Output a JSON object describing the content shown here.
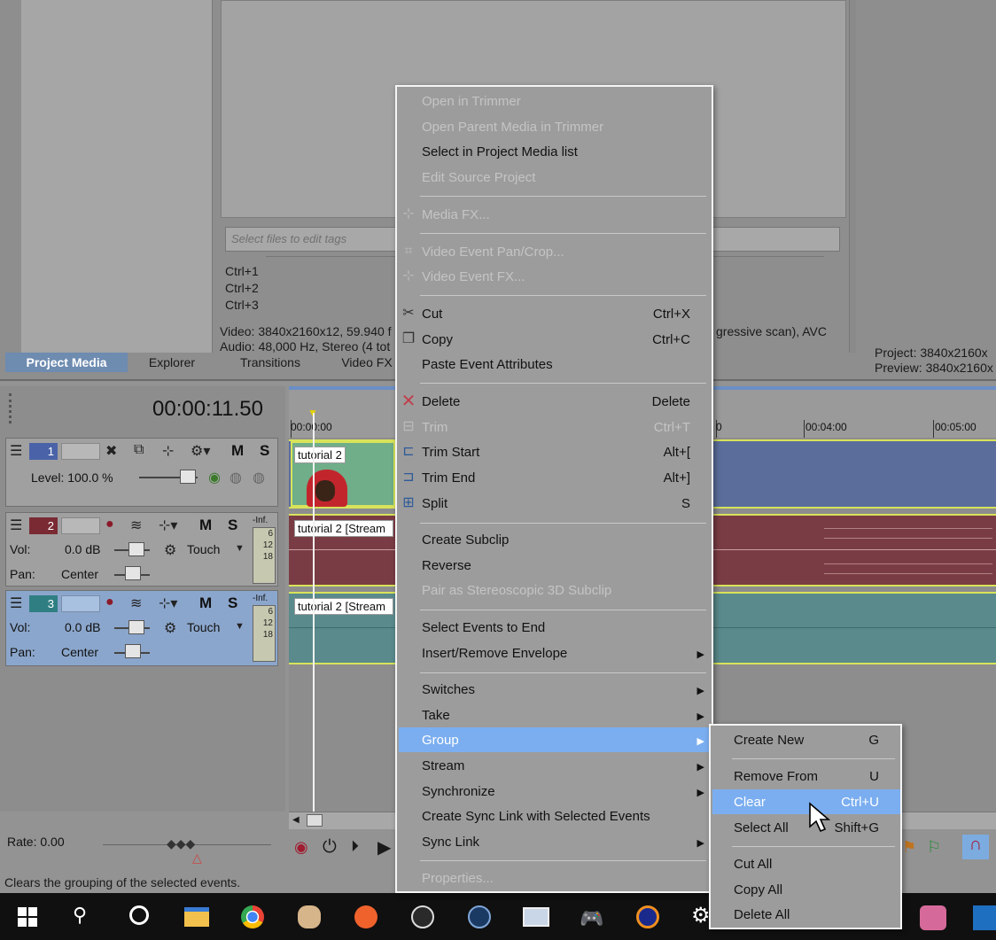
{
  "top": {
    "tags_placeholder": "Select files to edit tags",
    "shortcuts": [
      "Ctrl+1",
      "Ctrl+2",
      "Ctrl+3"
    ],
    "media_info": {
      "video": "Video: 3840x2160x12, 59.940 f",
      "audio": "Audio: 48,000 Hz, Stereo (4 tot",
      "video_suffix": "gressive scan), AVC"
    },
    "project_info": {
      "project": "Project:  3840x2160x",
      "preview": "Preview:  3840x2160x"
    },
    "tabs": [
      {
        "label": "Project Media",
        "active": true
      },
      {
        "label": "Explorer",
        "active": false
      },
      {
        "label": "Transitions",
        "active": false
      },
      {
        "label": "Video FX",
        "active": false
      }
    ]
  },
  "timeline": {
    "timecode": "00:00:11.50",
    "ruler_labels": [
      "00:00:00",
      "0",
      "00:04:00",
      "00:05:00"
    ],
    "tracks": [
      {
        "number": "1",
        "type": "video",
        "level_label": "Level: 100.0 %",
        "buttons": {
          "mute": "M",
          "solo": "S"
        },
        "clip_label": "tutorial 2"
      },
      {
        "number": "2",
        "type": "audio",
        "vol_label": "Vol:",
        "vol_value": "0.0 dB",
        "pan_label": "Pan:",
        "pan_value": "Center",
        "automation": "Touch",
        "buttons": {
          "mute": "M",
          "solo": "S"
        },
        "meter": [
          "-Inf.",
          "6",
          "12",
          "18"
        ],
        "clip_label": "tutorial 2 [Stream"
      },
      {
        "number": "3",
        "type": "audio",
        "vol_label": "Vol:",
        "vol_value": "0.0 dB",
        "pan_label": "Pan:",
        "pan_value": "Center",
        "automation": "Touch",
        "buttons": {
          "mute": "M",
          "solo": "S"
        },
        "meter": [
          "-Inf.",
          "6",
          "12",
          "18"
        ],
        "clip_label": "tutorial 2 [Stream"
      }
    ],
    "rate_label": "Rate: 0.00"
  },
  "status_bar": {
    "text": "Clears the grouping of the selected events."
  },
  "context_menu": {
    "items": [
      {
        "label": "Open in Trimmer",
        "disabled": true
      },
      {
        "label": "Open Parent Media in Trimmer",
        "disabled": true
      },
      {
        "label": "Select in Project Media list",
        "disabled": false
      },
      {
        "label": "Edit Source Project",
        "disabled": true
      },
      {
        "label": "Media FX...",
        "disabled": true,
        "icon": "media-fx-icon"
      },
      {
        "label": "Video Event Pan/Crop...",
        "disabled": true,
        "icon": "pan-crop-icon"
      },
      {
        "label": "Video Event FX...",
        "disabled": true,
        "icon": "event-fx-icon"
      },
      {
        "label": "Cut",
        "shortcut": "Ctrl+X",
        "disabled": false,
        "icon": "scissors-icon"
      },
      {
        "label": "Copy",
        "shortcut": "Ctrl+C",
        "disabled": false,
        "icon": "copy-icon"
      },
      {
        "label": "Paste Event Attributes",
        "disabled": false
      },
      {
        "label": "Delete",
        "shortcut": "Delete",
        "disabled": false,
        "icon": "delete-x-icon"
      },
      {
        "label": "Trim",
        "shortcut": "Ctrl+T",
        "disabled": true,
        "icon": "trim-icon"
      },
      {
        "label": "Trim Start",
        "shortcut": "Alt+[",
        "disabled": false,
        "icon": "trim-start-icon"
      },
      {
        "label": "Trim End",
        "shortcut": "Alt+]",
        "disabled": false,
        "icon": "trim-end-icon"
      },
      {
        "label": "Split",
        "shortcut": "S",
        "disabled": false,
        "icon": "split-icon"
      },
      {
        "label": "Create Subclip",
        "disabled": false
      },
      {
        "label": "Reverse",
        "disabled": false
      },
      {
        "label": "Pair as Stereoscopic 3D Subclip",
        "disabled": true
      },
      {
        "label": "Select Events to End",
        "disabled": false
      },
      {
        "label": "Insert/Remove Envelope",
        "disabled": false,
        "submenu": true
      },
      {
        "label": "Switches",
        "disabled": false,
        "submenu": true
      },
      {
        "label": "Take",
        "disabled": false,
        "submenu": true
      },
      {
        "label": "Group",
        "disabled": false,
        "submenu": true,
        "highlighted": true
      },
      {
        "label": "Stream",
        "disabled": false,
        "submenu": true
      },
      {
        "label": "Synchronize",
        "disabled": false,
        "submenu": true
      },
      {
        "label": "Create Sync Link with Selected Events",
        "disabled": false
      },
      {
        "label": "Sync Link",
        "disabled": false,
        "submenu": true
      },
      {
        "label": "Properties...",
        "disabled": true
      }
    ]
  },
  "group_submenu": {
    "items": [
      {
        "label": "Create New",
        "shortcut": "G"
      },
      {
        "label": "Remove From",
        "shortcut": "U"
      },
      {
        "label": "Clear",
        "shortcut": "Ctrl+U",
        "highlighted": true
      },
      {
        "label": "Select All",
        "shortcut": "Shift+G"
      },
      {
        "label": "Cut All",
        "shortcut": ""
      },
      {
        "label": "Copy All",
        "shortcut": ""
      },
      {
        "label": "Delete All",
        "shortcut": ""
      }
    ]
  },
  "taskbar": {
    "icons": [
      "windows-start-icon",
      "search-icon",
      "cortana-icon",
      "file-explorer-icon",
      "chrome-icon",
      "paint-icon",
      "origin-icon",
      "obs-icon",
      "steam-icon",
      "monitor-icon",
      "gamepad-icon",
      "headphones-icon",
      "settings-icon",
      "anime-app-icon",
      "vscode-icon"
    ]
  },
  "colors": {
    "menu_highlight": "#7baef0",
    "video_track": "#5b6d9b",
    "audio_track_2": "#7a3c44",
    "audio_track_3": "#5a8a8c",
    "track_border": "#d8e35a",
    "active_tab": "#6e8bb0"
  }
}
